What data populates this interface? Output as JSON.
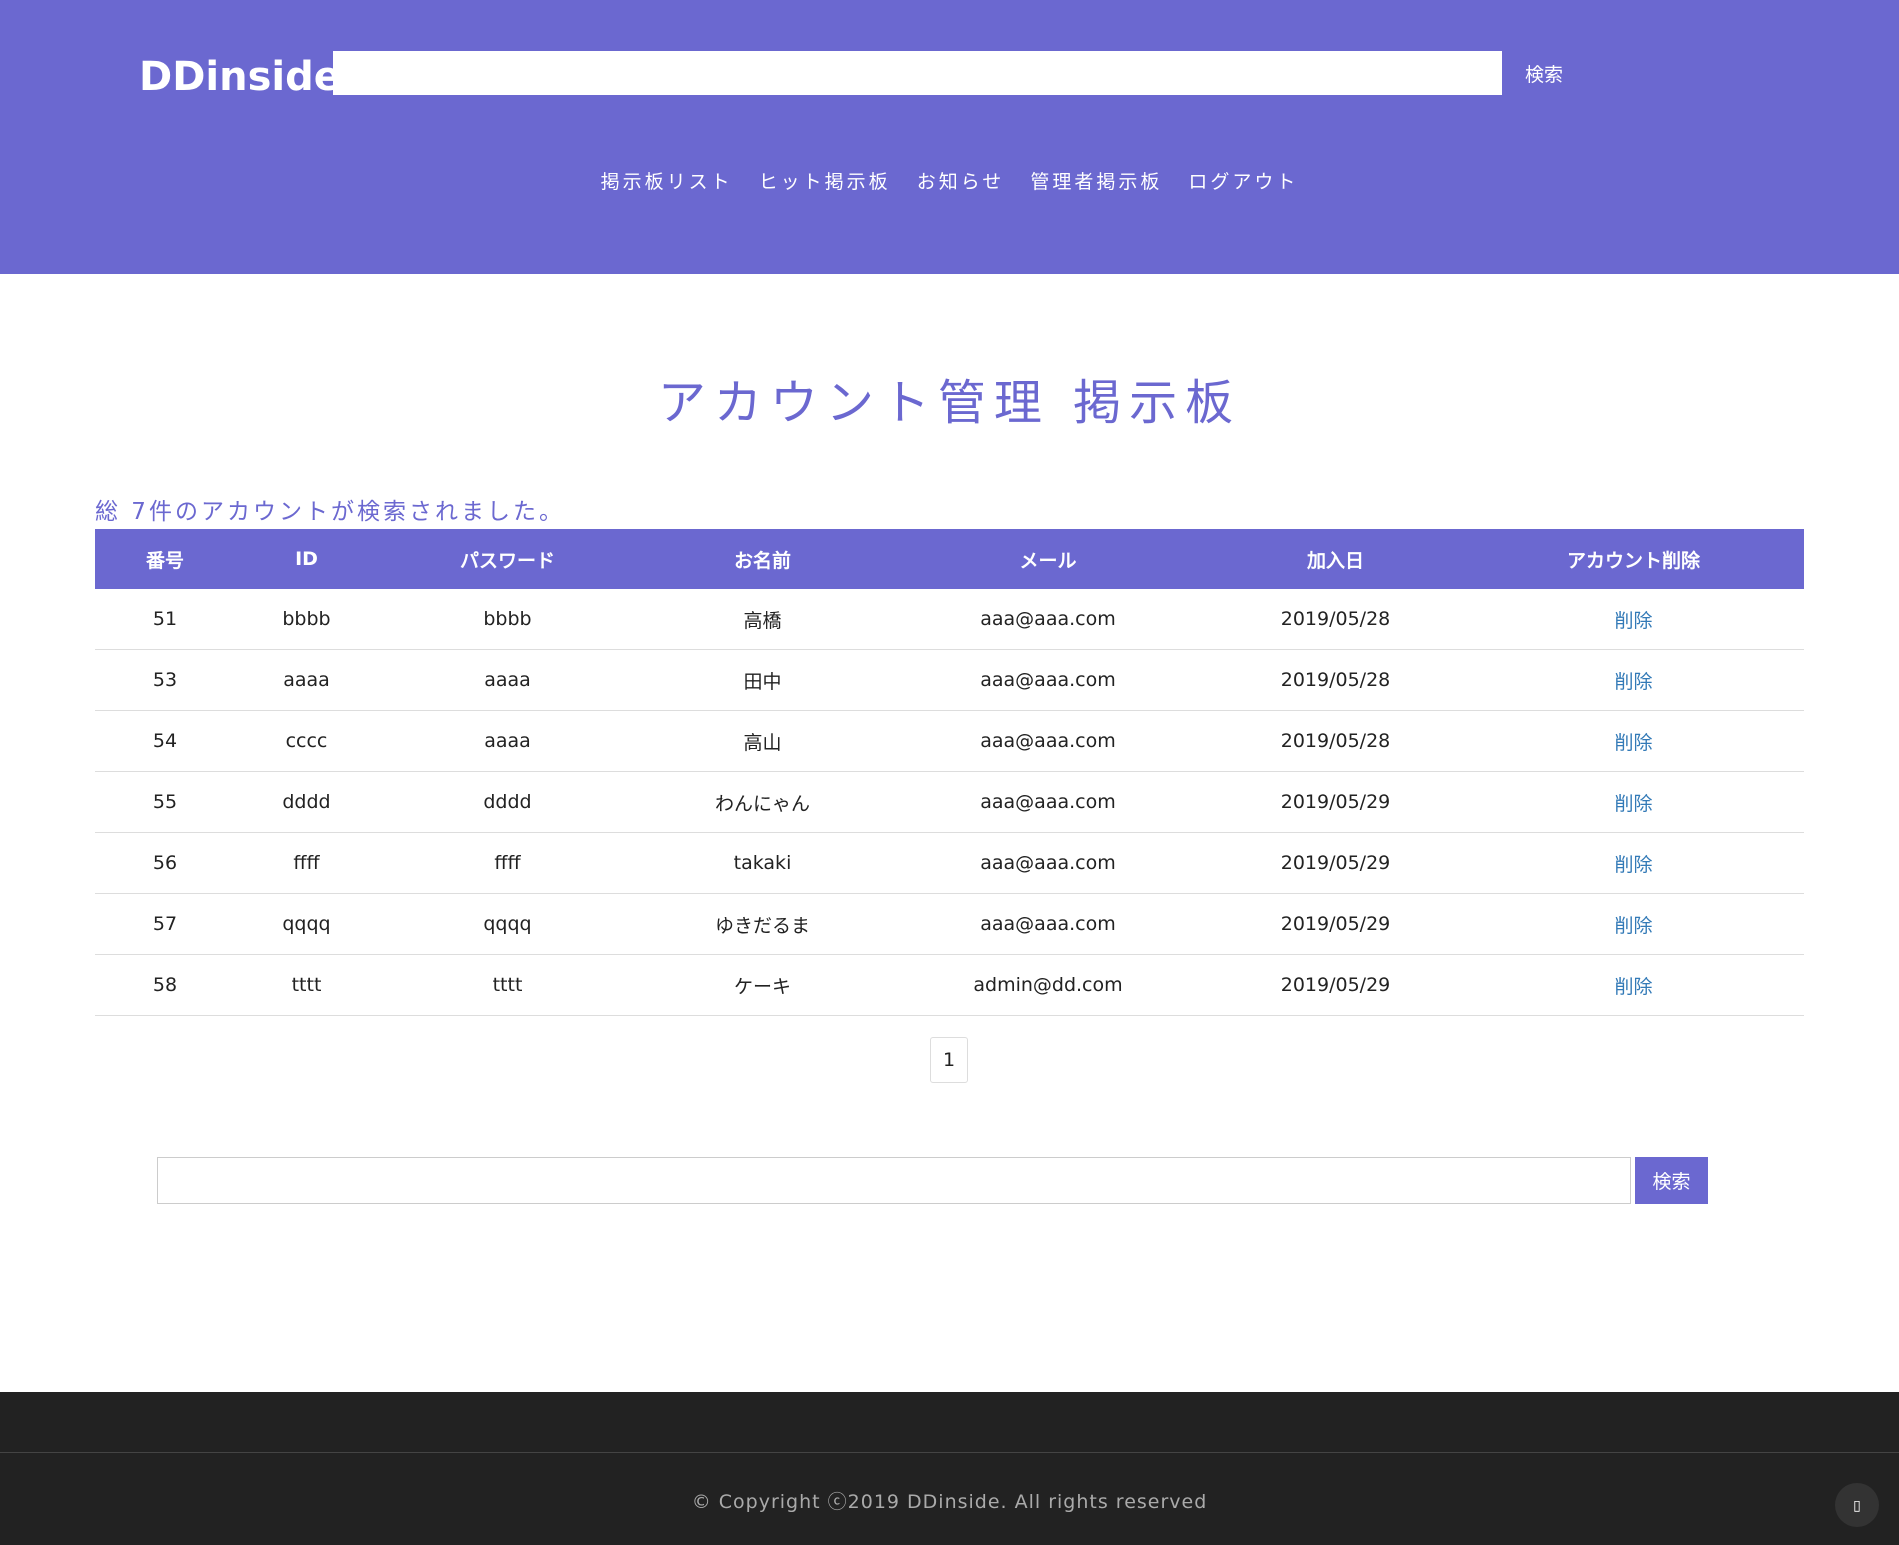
{
  "header": {
    "logo": "DDinside",
    "search": {
      "value": "",
      "placeholder": "",
      "button_label": "検索"
    },
    "nav": [
      "掲示板リスト",
      "ヒット掲示板",
      "お知らせ",
      "管理者掲示板",
      "ログアウト"
    ]
  },
  "main": {
    "title": "アカウント管理 掲示板",
    "result_count": "総 7件のアカウントが検索されました。",
    "table": {
      "columns": [
        "番号",
        "ID",
        "パスワード",
        "お名前",
        "メール",
        "加入日",
        "アカウント削除"
      ],
      "rows": [
        [
          "51",
          "bbbb",
          "bbbb",
          "高橋",
          "aaa@aaa.com",
          "2019/05/28",
          "削除"
        ],
        [
          "53",
          "aaaa",
          "aaaa",
          "田中",
          "aaa@aaa.com",
          "2019/05/28",
          "削除"
        ],
        [
          "54",
          "cccc",
          "aaaa",
          "高山",
          "aaa@aaa.com",
          "2019/05/28",
          "削除"
        ],
        [
          "55",
          "dddd",
          "dddd",
          "わんにゃん",
          "aaa@aaa.com",
          "2019/05/29",
          "削除"
        ],
        [
          "56",
          "ffff",
          "ffff",
          "takaki",
          "aaa@aaa.com",
          "2019/05/29",
          "削除"
        ],
        [
          "57",
          "qqqq",
          "qqqq",
          "ゆきだるま",
          "aaa@aaa.com",
          "2019/05/29",
          "削除"
        ],
        [
          "58",
          "tttt",
          "tttt",
          "ケーキ",
          "admin@dd.com",
          "2019/05/29",
          "削除"
        ]
      ]
    },
    "pagination": {
      "current": "1"
    },
    "bottom_search": {
      "value": "",
      "placeholder": "",
      "button_label": "検索"
    }
  },
  "footer": {
    "copyright": "© Copyright ⓒ2019 DDinside. All rights reserved",
    "scroll_top_icon": "arrow-up-icon"
  },
  "colors": {
    "brand": "#6b68d0",
    "link": "#337ab7",
    "footer_bg": "#222222"
  }
}
